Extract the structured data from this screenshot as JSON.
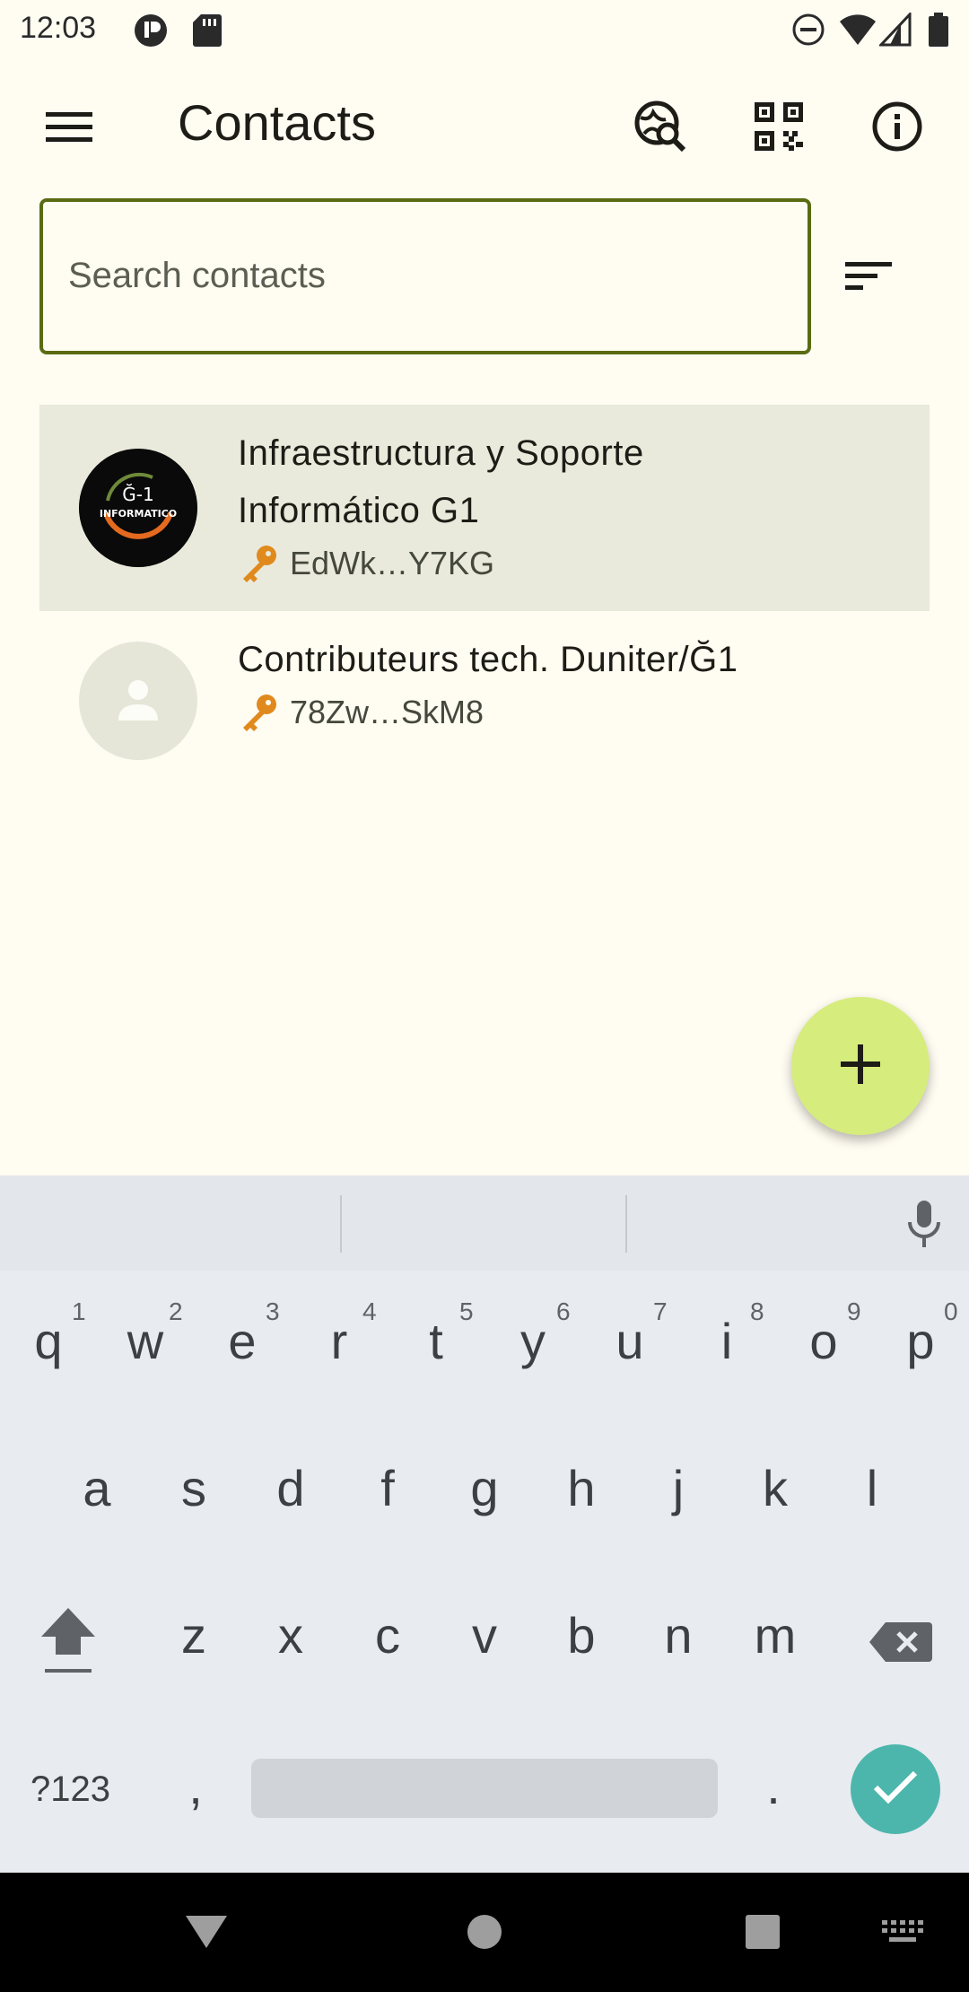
{
  "status_bar": {
    "time": "12:03"
  },
  "app_bar": {
    "title": "Contacts",
    "menu_icon": "menu-icon",
    "actions": [
      "search-globe-icon",
      "qr-code-icon",
      "info-icon"
    ]
  },
  "search": {
    "placeholder": "Search contacts",
    "value": "",
    "sort_icon": "sort-icon"
  },
  "contacts": [
    {
      "name_line1": "Infraestructura y Soporte",
      "name_line2": "Informático G1",
      "key": "EdWk…Y7KG",
      "avatar_text_top": "Ğ-1",
      "avatar_text_bottom": "INFORMATICO",
      "selected": true
    },
    {
      "name_line1": "Contributeurs tech. Duniter/Ğ1",
      "key": "78Zw…SkM8",
      "avatar": "person-icon",
      "selected": false
    }
  ],
  "fab": {
    "icon": "add-icon"
  },
  "keyboard": {
    "row1": [
      "q",
      "w",
      "e",
      "r",
      "t",
      "y",
      "u",
      "i",
      "o",
      "p"
    ],
    "row1_hints": [
      "1",
      "2",
      "3",
      "4",
      "5",
      "6",
      "7",
      "8",
      "9",
      "0"
    ],
    "row2": [
      "a",
      "s",
      "d",
      "f",
      "g",
      "h",
      "j",
      "k",
      "l"
    ],
    "row3": [
      "z",
      "x",
      "c",
      "v",
      "b",
      "n",
      "m"
    ],
    "symbols_label": "?123",
    "comma": ",",
    "period": "."
  },
  "colors": {
    "background": "#fffcf2",
    "search_border": "#5a6b12",
    "selected_row": "#e9eadb",
    "fab": "#d6ec7d",
    "key_icon": "#e08a1e",
    "enter_key": "#4db6ac"
  }
}
